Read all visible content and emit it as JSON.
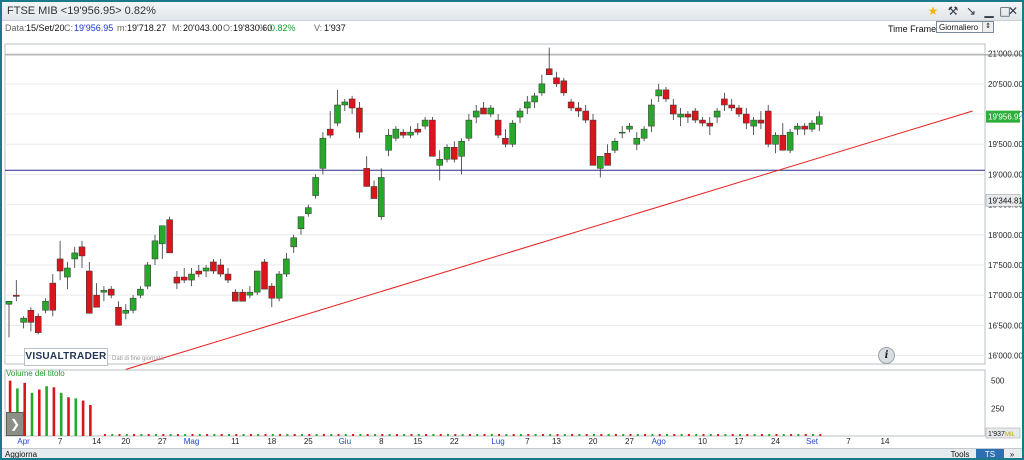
{
  "window": {
    "title": "FTSE MIB  <19'956.95>  0.82%",
    "icons": [
      "star-icon",
      "hammer-icon",
      "pin-icon",
      "minimize-icon",
      "maximize-icon",
      "close-icon"
    ]
  },
  "info": {
    "date_label": "Data:",
    "date": "15/Set/20",
    "close_label": "C:",
    "close": "19'956.95",
    "low_label": "m:",
    "low": "19'718.27",
    "high_label": "M:",
    "high": "20'043.00",
    "open_label": "O:",
    "open": "19'830.60",
    "pct_label": "%:",
    "pct": "0.82%",
    "vol_label": "V:",
    "vol": "1'937"
  },
  "timeframe": {
    "label": "Time Frame",
    "selected": "Giornaliero"
  },
  "branding": {
    "logo": "VISUALTRADER",
    "sub": "Dati di fine giornata"
  },
  "bottom": {
    "aggiorna": "Aggiorna",
    "tools": "Tools",
    "ts_off": "TS OFF",
    "more": "»"
  },
  "colors": {
    "up": "#27a82a",
    "down": "#d8161b",
    "trendline": "#e62020",
    "hline": "#2a2a8c",
    "border": "#1b7a8a"
  },
  "chart_data": {
    "type": "candlestick",
    "y_ticks": [
      "21'000.00",
      "20'500.00",
      "20'000.00",
      "19'500.00",
      "19'000.00",
      "18'500.00",
      "18'000.00",
      "17'500.00",
      "17'000.00",
      "16'500.00",
      "16'000.00"
    ],
    "y_tick_values": [
      21000,
      20500,
      20000,
      19500,
      19000,
      18500,
      18000,
      17500,
      17000,
      16500,
      16000
    ],
    "ylim": [
      15860,
      21160
    ],
    "last_price_label": "19'956.95",
    "hline_label": "19'344.81",
    "hline_value": 19070,
    "hline_top_value": 20980,
    "trendline": {
      "from": {
        "bar": 16,
        "value": 15770
      },
      "to": {
        "bar": 132,
        "value": 20050
      }
    },
    "x_labels": [
      {
        "text": "Apr",
        "bar": 2,
        "month": true
      },
      {
        "text": "7",
        "bar": 7
      },
      {
        "text": "14",
        "bar": 12
      },
      {
        "text": "20",
        "bar": 16
      },
      {
        "text": "27",
        "bar": 21
      },
      {
        "text": "Mag",
        "bar": 25,
        "month": true
      },
      {
        "text": "11",
        "bar": 31
      },
      {
        "text": "18",
        "bar": 36
      },
      {
        "text": "25",
        "bar": 41
      },
      {
        "text": "Giu",
        "bar": 46,
        "month": true
      },
      {
        "text": "8",
        "bar": 51
      },
      {
        "text": "15",
        "bar": 56
      },
      {
        "text": "22",
        "bar": 61
      },
      {
        "text": "Lug",
        "bar": 67,
        "month": true
      },
      {
        "text": "7",
        "bar": 71
      },
      {
        "text": "13",
        "bar": 75
      },
      {
        "text": "20",
        "bar": 80
      },
      {
        "text": "27",
        "bar": 85
      },
      {
        "text": "Ago",
        "bar": 89,
        "month": true
      },
      {
        "text": "10",
        "bar": 95
      },
      {
        "text": "17",
        "bar": 100
      },
      {
        "text": "24",
        "bar": 105
      },
      {
        "text": "Set",
        "bar": 110,
        "month": true
      },
      {
        "text": "7",
        "bar": 115
      },
      {
        "text": "14",
        "bar": 120
      }
    ],
    "candles": [
      {
        "o": 16850,
        "h": 16900,
        "l": 16300,
        "c": 16900
      },
      {
        "o": 17000,
        "h": 17250,
        "l": 16900,
        "c": 16980
      },
      {
        "o": 16550,
        "h": 16650,
        "l": 16450,
        "c": 16620
      },
      {
        "o": 16750,
        "h": 16800,
        "l": 16400,
        "c": 16550
      },
      {
        "o": 16650,
        "h": 16700,
        "l": 16350,
        "c": 16380
      },
      {
        "o": 16750,
        "h": 16950,
        "l": 16700,
        "c": 16900
      },
      {
        "o": 17200,
        "h": 17350,
        "l": 16650,
        "c": 16750
      },
      {
        "o": 17600,
        "h": 17900,
        "l": 17250,
        "c": 17400
      },
      {
        "o": 17300,
        "h": 17550,
        "l": 17100,
        "c": 17450
      },
      {
        "o": 17600,
        "h": 17800,
        "l": 17450,
        "c": 17700
      },
      {
        "o": 17800,
        "h": 17900,
        "l": 17450,
        "c": 17650
      },
      {
        "o": 17400,
        "h": 17550,
        "l": 16750,
        "c": 16700
      },
      {
        "o": 17000,
        "h": 17200,
        "l": 16900,
        "c": 16800
      },
      {
        "o": 17050,
        "h": 17150,
        "l": 16900,
        "c": 17080
      },
      {
        "o": 17100,
        "h": 17150,
        "l": 16950,
        "c": 17000
      },
      {
        "o": 16800,
        "h": 16900,
        "l": 16500,
        "c": 16500
      },
      {
        "o": 16700,
        "h": 16850,
        "l": 16600,
        "c": 16750
      },
      {
        "o": 16750,
        "h": 17000,
        "l": 16700,
        "c": 16950
      },
      {
        "o": 17000,
        "h": 17150,
        "l": 16950,
        "c": 17100
      },
      {
        "o": 17150,
        "h": 17550,
        "l": 17100,
        "c": 17500
      },
      {
        "o": 17600,
        "h": 18000,
        "l": 17500,
        "c": 17900
      },
      {
        "o": 17850,
        "h": 18150,
        "l": 17600,
        "c": 18150
      },
      {
        "o": 18250,
        "h": 18300,
        "l": 17700,
        "c": 17700
      },
      {
        "o": 17300,
        "h": 17400,
        "l": 17100,
        "c": 17200
      },
      {
        "o": 17300,
        "h": 17450,
        "l": 17200,
        "c": 17250
      },
      {
        "o": 17250,
        "h": 17450,
        "l": 17150,
        "c": 17350
      },
      {
        "o": 17400,
        "h": 17500,
        "l": 17300,
        "c": 17350
      },
      {
        "o": 17400,
        "h": 17500,
        "l": 17300,
        "c": 17450
      },
      {
        "o": 17550,
        "h": 17600,
        "l": 17350,
        "c": 17400
      },
      {
        "o": 17500,
        "h": 17600,
        "l": 17300,
        "c": 17350
      },
      {
        "o": 17350,
        "h": 17450,
        "l": 17200,
        "c": 17250
      },
      {
        "o": 17050,
        "h": 17100,
        "l": 16900,
        "c": 16900
      },
      {
        "o": 17050,
        "h": 17100,
        "l": 16950,
        "c": 16900
      },
      {
        "o": 17000,
        "h": 17150,
        "l": 16950,
        "c": 17050
      },
      {
        "o": 17050,
        "h": 17400,
        "l": 17000,
        "c": 17400
      },
      {
        "o": 17550,
        "h": 17600,
        "l": 17100,
        "c": 17100
      },
      {
        "o": 17150,
        "h": 17200,
        "l": 16800,
        "c": 16950
      },
      {
        "o": 16950,
        "h": 17400,
        "l": 16900,
        "c": 17350
      },
      {
        "o": 17350,
        "h": 17700,
        "l": 17300,
        "c": 17600
      },
      {
        "o": 17800,
        "h": 18000,
        "l": 17700,
        "c": 17950
      },
      {
        "o": 18100,
        "h": 18300,
        "l": 18000,
        "c": 18300
      },
      {
        "o": 18350,
        "h": 18500,
        "l": 18300,
        "c": 18450
      },
      {
        "o": 18650,
        "h": 19000,
        "l": 18600,
        "c": 18950
      },
      {
        "o": 19100,
        "h": 19700,
        "l": 19000,
        "c": 19600
      },
      {
        "o": 19750,
        "h": 20050,
        "l": 19600,
        "c": 19650
      },
      {
        "o": 19850,
        "h": 20400,
        "l": 19800,
        "c": 20150
      },
      {
        "o": 20150,
        "h": 20250,
        "l": 20050,
        "c": 20200
      },
      {
        "o": 20250,
        "h": 20300,
        "l": 20000,
        "c": 20100
      },
      {
        "o": 20100,
        "h": 20200,
        "l": 19600,
        "c": 19700
      },
      {
        "o": 19100,
        "h": 19300,
        "l": 18900,
        "c": 18800
      },
      {
        "o": 18800,
        "h": 18900,
        "l": 18600,
        "c": 18600
      },
      {
        "o": 18300,
        "h": 19100,
        "l": 18250,
        "c": 18950
      },
      {
        "o": 19400,
        "h": 19750,
        "l": 19300,
        "c": 19650
      },
      {
        "o": 19600,
        "h": 19800,
        "l": 19550,
        "c": 19750
      },
      {
        "o": 19700,
        "h": 19750,
        "l": 19600,
        "c": 19650
      },
      {
        "o": 19650,
        "h": 19800,
        "l": 19600,
        "c": 19700
      },
      {
        "o": 19750,
        "h": 19850,
        "l": 19650,
        "c": 19700
      },
      {
        "o": 19800,
        "h": 19950,
        "l": 19750,
        "c": 19900
      },
      {
        "o": 19900,
        "h": 19950,
        "l": 19300,
        "c": 19300
      },
      {
        "o": 19150,
        "h": 19400,
        "l": 18900,
        "c": 19250
      },
      {
        "o": 19250,
        "h": 19500,
        "l": 19200,
        "c": 19450
      },
      {
        "o": 19450,
        "h": 19550,
        "l": 19200,
        "c": 19250
      },
      {
        "o": 19300,
        "h": 19600,
        "l": 19000,
        "c": 19550
      },
      {
        "o": 19600,
        "h": 20000,
        "l": 19550,
        "c": 19900
      },
      {
        "o": 19950,
        "h": 20150,
        "l": 19850,
        "c": 20050
      },
      {
        "o": 20100,
        "h": 20200,
        "l": 20000,
        "c": 20000
      },
      {
        "o": 20000,
        "h": 20150,
        "l": 19950,
        "c": 20100
      },
      {
        "o": 19900,
        "h": 20000,
        "l": 19600,
        "c": 19650
      },
      {
        "o": 19600,
        "h": 19750,
        "l": 19450,
        "c": 19500
      },
      {
        "o": 19500,
        "h": 19900,
        "l": 19450,
        "c": 19850
      },
      {
        "o": 19950,
        "h": 20100,
        "l": 19850,
        "c": 20050
      },
      {
        "o": 20100,
        "h": 20300,
        "l": 20000,
        "c": 20200
      },
      {
        "o": 20200,
        "h": 20350,
        "l": 20100,
        "c": 20300
      },
      {
        "o": 20350,
        "h": 20650,
        "l": 20300,
        "c": 20500
      },
      {
        "o": 20750,
        "h": 21100,
        "l": 20700,
        "c": 20650
      },
      {
        "o": 20600,
        "h": 20700,
        "l": 20450,
        "c": 20500
      },
      {
        "o": 20550,
        "h": 20600,
        "l": 20300,
        "c": 20350
      },
      {
        "o": 20200,
        "h": 20250,
        "l": 20050,
        "c": 20100
      },
      {
        "o": 20100,
        "h": 20200,
        "l": 19950,
        "c": 20050
      },
      {
        "o": 20050,
        "h": 20150,
        "l": 19850,
        "c": 19900
      },
      {
        "o": 19900,
        "h": 20000,
        "l": 19150,
        "c": 19150
      },
      {
        "o": 19100,
        "h": 19300,
        "l": 18950,
        "c": 19300
      },
      {
        "o": 19350,
        "h": 19500,
        "l": 19150,
        "c": 19150
      },
      {
        "o": 19400,
        "h": 19600,
        "l": 19350,
        "c": 19550
      },
      {
        "o": 19700,
        "h": 19800,
        "l": 19600,
        "c": 19700
      },
      {
        "o": 19750,
        "h": 19850,
        "l": 19700,
        "c": 19800
      },
      {
        "o": 19500,
        "h": 19700,
        "l": 19400,
        "c": 19600
      },
      {
        "o": 19600,
        "h": 19800,
        "l": 19550,
        "c": 19750
      },
      {
        "o": 19800,
        "h": 20250,
        "l": 19700,
        "c": 20150
      },
      {
        "o": 20300,
        "h": 20500,
        "l": 20200,
        "c": 20400
      },
      {
        "o": 20400,
        "h": 20450,
        "l": 20200,
        "c": 20250
      },
      {
        "o": 20150,
        "h": 20250,
        "l": 19900,
        "c": 20000
      },
      {
        "o": 19950,
        "h": 20100,
        "l": 19800,
        "c": 20000
      },
      {
        "o": 20000,
        "h": 20050,
        "l": 19850,
        "c": 19950
      },
      {
        "o": 20050,
        "h": 20100,
        "l": 19850,
        "c": 19900
      },
      {
        "o": 19900,
        "h": 19950,
        "l": 19800,
        "c": 19850
      },
      {
        "o": 19850,
        "h": 19950,
        "l": 19650,
        "c": 19800
      },
      {
        "o": 19950,
        "h": 20100,
        "l": 19850,
        "c": 20050
      },
      {
        "o": 20250,
        "h": 20350,
        "l": 20050,
        "c": 20150
      },
      {
        "o": 20150,
        "h": 20250,
        "l": 20050,
        "c": 20100
      },
      {
        "o": 20100,
        "h": 20150,
        "l": 19950,
        "c": 20000
      },
      {
        "o": 20000,
        "h": 20100,
        "l": 19750,
        "c": 19850
      },
      {
        "o": 19800,
        "h": 19950,
        "l": 19650,
        "c": 19900
      },
      {
        "o": 19900,
        "h": 20050,
        "l": 19750,
        "c": 19850
      },
      {
        "o": 20050,
        "h": 20150,
        "l": 19450,
        "c": 19500
      },
      {
        "o": 19500,
        "h": 19700,
        "l": 19350,
        "c": 19650
      },
      {
        "o": 19650,
        "h": 19850,
        "l": 19400,
        "c": 19400
      },
      {
        "o": 19400,
        "h": 19750,
        "l": 19350,
        "c": 19700
      },
      {
        "o": 19750,
        "h": 19850,
        "l": 19650,
        "c": 19800
      },
      {
        "o": 19800,
        "h": 19850,
        "l": 19650,
        "c": 19750
      },
      {
        "o": 19750,
        "h": 19900,
        "l": 19700,
        "c": 19850
      },
      {
        "o": 19830,
        "h": 20043,
        "l": 19718,
        "c": 19957
      }
    ]
  },
  "volume": {
    "label": "Volume del titolo",
    "y_ticks": [
      "500",
      "250"
    ],
    "y_tick_values": [
      500,
      250
    ],
    "ymax": 560,
    "last_label": "1'937",
    "last_unit": "MIL",
    "bars": [
      {
        "v": 500,
        "up": false
      },
      {
        "v": 430,
        "up": true
      },
      {
        "v": 480,
        "up": false
      },
      {
        "v": 390,
        "up": true
      },
      {
        "v": 420,
        "up": false
      },
      {
        "v": 450,
        "up": true
      },
      {
        "v": 440,
        "up": false
      },
      {
        "v": 390,
        "up": true
      },
      {
        "v": 350,
        "up": false
      },
      {
        "v": 340,
        "up": true
      },
      {
        "v": 320,
        "up": false
      },
      {
        "v": 280,
        "up": false
      }
    ]
  }
}
